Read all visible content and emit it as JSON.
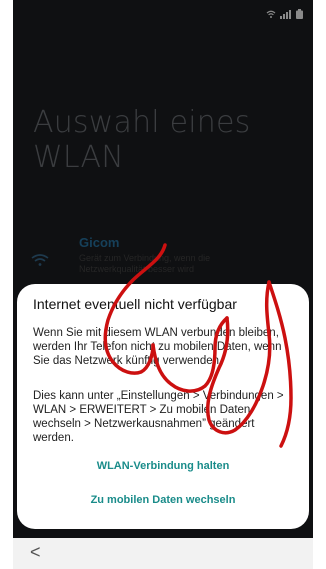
{
  "status_bar": {
    "icons": [
      "wifi-icon",
      "signal-icon",
      "battery-icon"
    ]
  },
  "page": {
    "title": "Auswahl eines WLAN"
  },
  "network": {
    "name": "Gicom",
    "description": "Gerät zum Verbindung, wenn die Netzwerkqualität besser wird"
  },
  "dialog": {
    "title": "Internet eventuell nicht verfügbar",
    "paragraph1": "Wenn Sie mit diesem WLAN verbunden bleiben, werden Ihr Telefon nicht zu mobilen Daten, wenn Sie das Netzwerk künftig verwenden.",
    "paragraph2": "Dies kann unter „Einstellungen > Verbindungen > WLAN > ERWEITERT > Zu mobilen Daten wechseln > Netzwerkausnahmen” geändert werden.",
    "action_keep": "WLAN-Verbindung halten",
    "action_switch": "Zu mobilen Daten wechseln"
  },
  "nav": {
    "back_symbol": "<"
  },
  "colors": {
    "accent": "#1a8c8a",
    "scribble": "#cc1010",
    "dim_background": "#0f1012"
  }
}
